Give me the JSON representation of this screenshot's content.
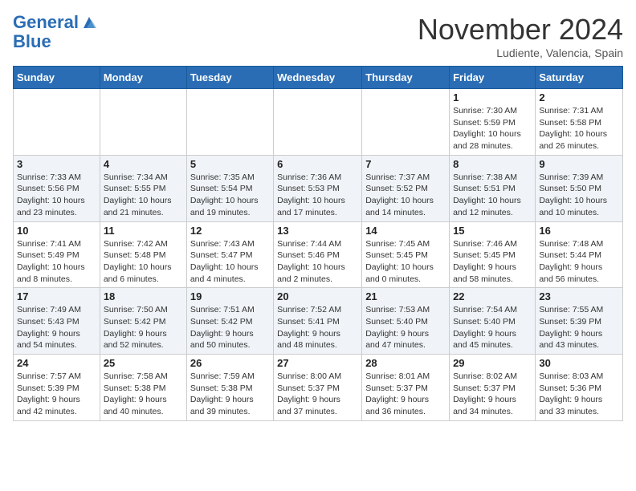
{
  "header": {
    "logo_line1": "General",
    "logo_line2": "Blue",
    "month": "November 2024",
    "location": "Ludiente, Valencia, Spain"
  },
  "weekdays": [
    "Sunday",
    "Monday",
    "Tuesday",
    "Wednesday",
    "Thursday",
    "Friday",
    "Saturday"
  ],
  "weeks": [
    [
      {
        "day": "",
        "info": ""
      },
      {
        "day": "",
        "info": ""
      },
      {
        "day": "",
        "info": ""
      },
      {
        "day": "",
        "info": ""
      },
      {
        "day": "",
        "info": ""
      },
      {
        "day": "1",
        "info": "Sunrise: 7:30 AM\nSunset: 5:59 PM\nDaylight: 10 hours\nand 28 minutes."
      },
      {
        "day": "2",
        "info": "Sunrise: 7:31 AM\nSunset: 5:58 PM\nDaylight: 10 hours\nand 26 minutes."
      }
    ],
    [
      {
        "day": "3",
        "info": "Sunrise: 7:33 AM\nSunset: 5:56 PM\nDaylight: 10 hours\nand 23 minutes."
      },
      {
        "day": "4",
        "info": "Sunrise: 7:34 AM\nSunset: 5:55 PM\nDaylight: 10 hours\nand 21 minutes."
      },
      {
        "day": "5",
        "info": "Sunrise: 7:35 AM\nSunset: 5:54 PM\nDaylight: 10 hours\nand 19 minutes."
      },
      {
        "day": "6",
        "info": "Sunrise: 7:36 AM\nSunset: 5:53 PM\nDaylight: 10 hours\nand 17 minutes."
      },
      {
        "day": "7",
        "info": "Sunrise: 7:37 AM\nSunset: 5:52 PM\nDaylight: 10 hours\nand 14 minutes."
      },
      {
        "day": "8",
        "info": "Sunrise: 7:38 AM\nSunset: 5:51 PM\nDaylight: 10 hours\nand 12 minutes."
      },
      {
        "day": "9",
        "info": "Sunrise: 7:39 AM\nSunset: 5:50 PM\nDaylight: 10 hours\nand 10 minutes."
      }
    ],
    [
      {
        "day": "10",
        "info": "Sunrise: 7:41 AM\nSunset: 5:49 PM\nDaylight: 10 hours\nand 8 minutes."
      },
      {
        "day": "11",
        "info": "Sunrise: 7:42 AM\nSunset: 5:48 PM\nDaylight: 10 hours\nand 6 minutes."
      },
      {
        "day": "12",
        "info": "Sunrise: 7:43 AM\nSunset: 5:47 PM\nDaylight: 10 hours\nand 4 minutes."
      },
      {
        "day": "13",
        "info": "Sunrise: 7:44 AM\nSunset: 5:46 PM\nDaylight: 10 hours\nand 2 minutes."
      },
      {
        "day": "14",
        "info": "Sunrise: 7:45 AM\nSunset: 5:45 PM\nDaylight: 10 hours\nand 0 minutes."
      },
      {
        "day": "15",
        "info": "Sunrise: 7:46 AM\nSunset: 5:45 PM\nDaylight: 9 hours\nand 58 minutes."
      },
      {
        "day": "16",
        "info": "Sunrise: 7:48 AM\nSunset: 5:44 PM\nDaylight: 9 hours\nand 56 minutes."
      }
    ],
    [
      {
        "day": "17",
        "info": "Sunrise: 7:49 AM\nSunset: 5:43 PM\nDaylight: 9 hours\nand 54 minutes."
      },
      {
        "day": "18",
        "info": "Sunrise: 7:50 AM\nSunset: 5:42 PM\nDaylight: 9 hours\nand 52 minutes."
      },
      {
        "day": "19",
        "info": "Sunrise: 7:51 AM\nSunset: 5:42 PM\nDaylight: 9 hours\nand 50 minutes."
      },
      {
        "day": "20",
        "info": "Sunrise: 7:52 AM\nSunset: 5:41 PM\nDaylight: 9 hours\nand 48 minutes."
      },
      {
        "day": "21",
        "info": "Sunrise: 7:53 AM\nSunset: 5:40 PM\nDaylight: 9 hours\nand 47 minutes."
      },
      {
        "day": "22",
        "info": "Sunrise: 7:54 AM\nSunset: 5:40 PM\nDaylight: 9 hours\nand 45 minutes."
      },
      {
        "day": "23",
        "info": "Sunrise: 7:55 AM\nSunset: 5:39 PM\nDaylight: 9 hours\nand 43 minutes."
      }
    ],
    [
      {
        "day": "24",
        "info": "Sunrise: 7:57 AM\nSunset: 5:39 PM\nDaylight: 9 hours\nand 42 minutes."
      },
      {
        "day": "25",
        "info": "Sunrise: 7:58 AM\nSunset: 5:38 PM\nDaylight: 9 hours\nand 40 minutes."
      },
      {
        "day": "26",
        "info": "Sunrise: 7:59 AM\nSunset: 5:38 PM\nDaylight: 9 hours\nand 39 minutes."
      },
      {
        "day": "27",
        "info": "Sunrise: 8:00 AM\nSunset: 5:37 PM\nDaylight: 9 hours\nand 37 minutes."
      },
      {
        "day": "28",
        "info": "Sunrise: 8:01 AM\nSunset: 5:37 PM\nDaylight: 9 hours\nand 36 minutes."
      },
      {
        "day": "29",
        "info": "Sunrise: 8:02 AM\nSunset: 5:37 PM\nDaylight: 9 hours\nand 34 minutes."
      },
      {
        "day": "30",
        "info": "Sunrise: 8:03 AM\nSunset: 5:36 PM\nDaylight: 9 hours\nand 33 minutes."
      }
    ]
  ]
}
